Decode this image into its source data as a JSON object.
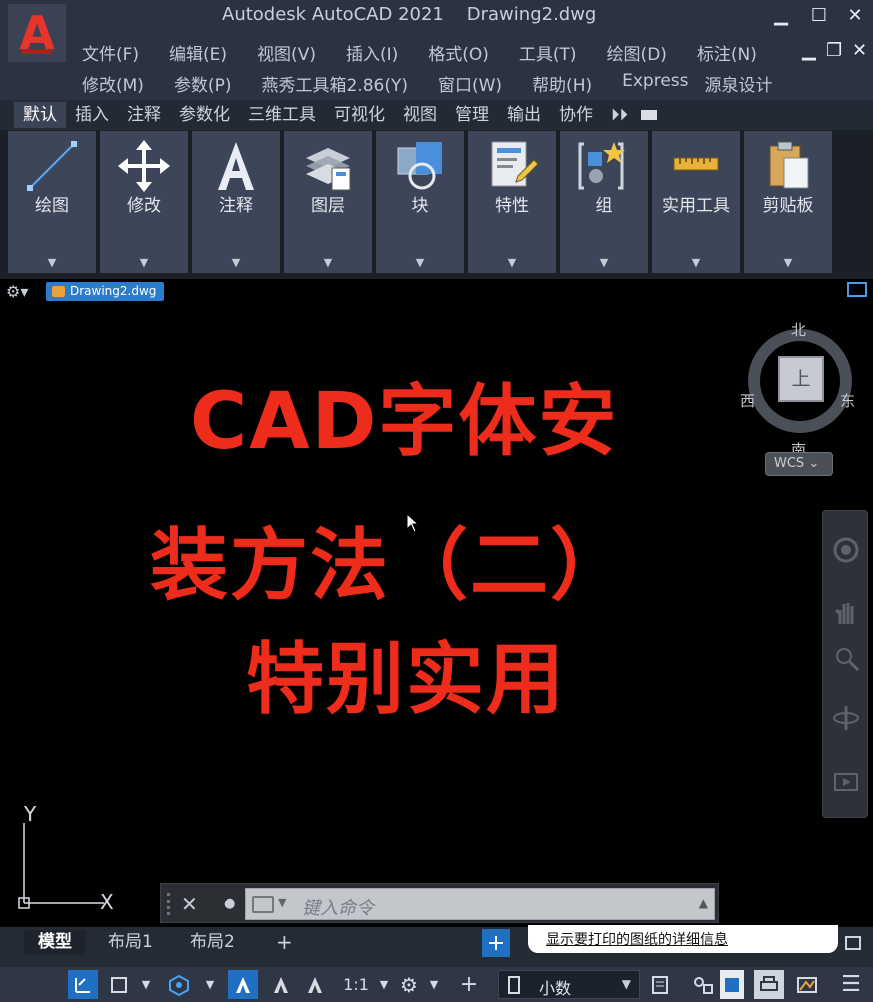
{
  "window": {
    "title": "Autodesk AutoCAD 2021    Drawing2.dwg",
    "minimize": "▁",
    "maximize": "☐",
    "close": "✕",
    "doc_minimize": "▁",
    "doc_restore": "❐",
    "doc_close": "✕"
  },
  "app_logo": "A",
  "menu_row_1": [
    "文件(F)",
    "编辑(E)",
    "视图(V)",
    "插入(I)",
    "格式(O)",
    "工具(T)",
    "绘图(D)",
    "标注(N)"
  ],
  "menu_row_2": [
    "修改(M)",
    "参数(P)",
    "燕秀工具箱2.86(Y)",
    "窗口(W)",
    "帮助(H)",
    "Express",
    "源泉设计"
  ],
  "ribbon": {
    "tabs": [
      "默认",
      "插入",
      "注释",
      "参数化",
      "三维工具",
      "可视化",
      "视图",
      "管理",
      "输出",
      "协作"
    ],
    "more": "⏵⏵",
    "panels": [
      {
        "label": "绘图",
        "icon": "line-icon"
      },
      {
        "label": "修改",
        "icon": "move-icon"
      },
      {
        "label": "注释",
        "icon": "text-icon"
      },
      {
        "label": "图层",
        "icon": "layers-icon"
      },
      {
        "label": "块",
        "icon": "block-icon"
      },
      {
        "label": "特性",
        "icon": "properties-icon"
      },
      {
        "label": "组",
        "icon": "group-icon"
      },
      {
        "label": "实用工具",
        "icon": "measure-icon"
      },
      {
        "label": "剪贴板",
        "icon": "clipboard-icon"
      }
    ]
  },
  "document": {
    "tab_label": "Drawing2.dwg"
  },
  "canvas": {
    "headline": [
      "CAD字体安",
      "装方法（二）",
      "特别实用"
    ],
    "accent": "#ee2c1b"
  },
  "viewcube": {
    "north": "北",
    "south": "南",
    "west": "西",
    "east": "东",
    "face": "上",
    "wcs": "WCS ⌄"
  },
  "ucs": {
    "y": "Y",
    "x": "X"
  },
  "command": {
    "placeholder": "键入命令",
    "close": "✕",
    "wrench": "🔧",
    "history": "▲"
  },
  "layout_tabs": {
    "model": "模型",
    "layout1": "布局1",
    "layout2": "布局2",
    "add": "+"
  },
  "balloon": {
    "text": "显示要打印的图纸的详细信息"
  },
  "status": {
    "scale": "1:1",
    "units": "小数"
  }
}
